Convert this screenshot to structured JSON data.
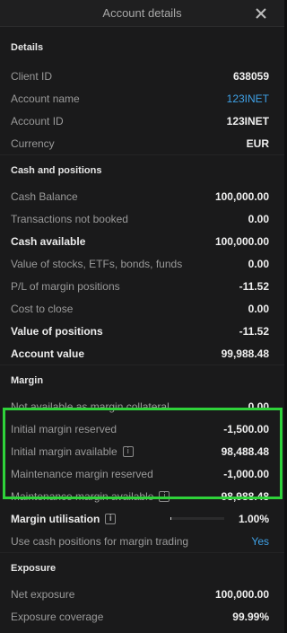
{
  "window": {
    "title": "Account details"
  },
  "details": {
    "heading": "Details",
    "client_id": {
      "label": "Client ID",
      "value": "638059"
    },
    "account_name": {
      "label": "Account name",
      "value": "123INET"
    },
    "account_id": {
      "label": "Account ID",
      "value": "123INET"
    },
    "currency": {
      "label": "Currency",
      "value": "EUR"
    }
  },
  "cash": {
    "heading": "Cash and positions",
    "cash_balance": {
      "label": "Cash Balance",
      "value": "100,000.00"
    },
    "tx_not_booked": {
      "label": "Transactions not booked",
      "value": "0.00"
    },
    "cash_available": {
      "label": "Cash available",
      "value": "100,000.00"
    },
    "value_stocks": {
      "label": "Value of stocks, ETFs, bonds, funds",
      "value": "0.00"
    },
    "pl_margin": {
      "label": "P/L of margin positions",
      "value": "-11.52"
    },
    "cost_close": {
      "label": "Cost to close",
      "value": "0.00"
    },
    "value_positions": {
      "label": "Value of positions",
      "value": "-11.52"
    },
    "account_value": {
      "label": "Account value",
      "value": "99,988.48"
    }
  },
  "margin": {
    "heading": "Margin",
    "not_available": {
      "label": "Not available as margin collateral",
      "value": "0.00"
    },
    "initial_reserved": {
      "label": "Initial margin reserved",
      "value": "-1,500.00"
    },
    "initial_available": {
      "label": "Initial margin available",
      "value": "98,488.48"
    },
    "maint_reserved": {
      "label": "Maintenance margin reserved",
      "value": "-1,000.00"
    },
    "maint_available": {
      "label": "Maintenance margin available",
      "value": "98,988.48"
    },
    "utilisation": {
      "label": "Margin utilisation",
      "value": "1.00%",
      "fraction": 0.01
    },
    "use_cash": {
      "label": "Use cash positions for margin trading",
      "value": "Yes"
    }
  },
  "exposure": {
    "heading": "Exposure",
    "net": {
      "label": "Net exposure",
      "value": "100,000.00"
    },
    "coverage": {
      "label": "Exposure coverage",
      "value": "99.99%"
    }
  },
  "icons": {
    "close": "close-icon",
    "info": "info-icon"
  },
  "colors": {
    "highlight": "#2fd23a",
    "link": "#3fa1e6"
  }
}
